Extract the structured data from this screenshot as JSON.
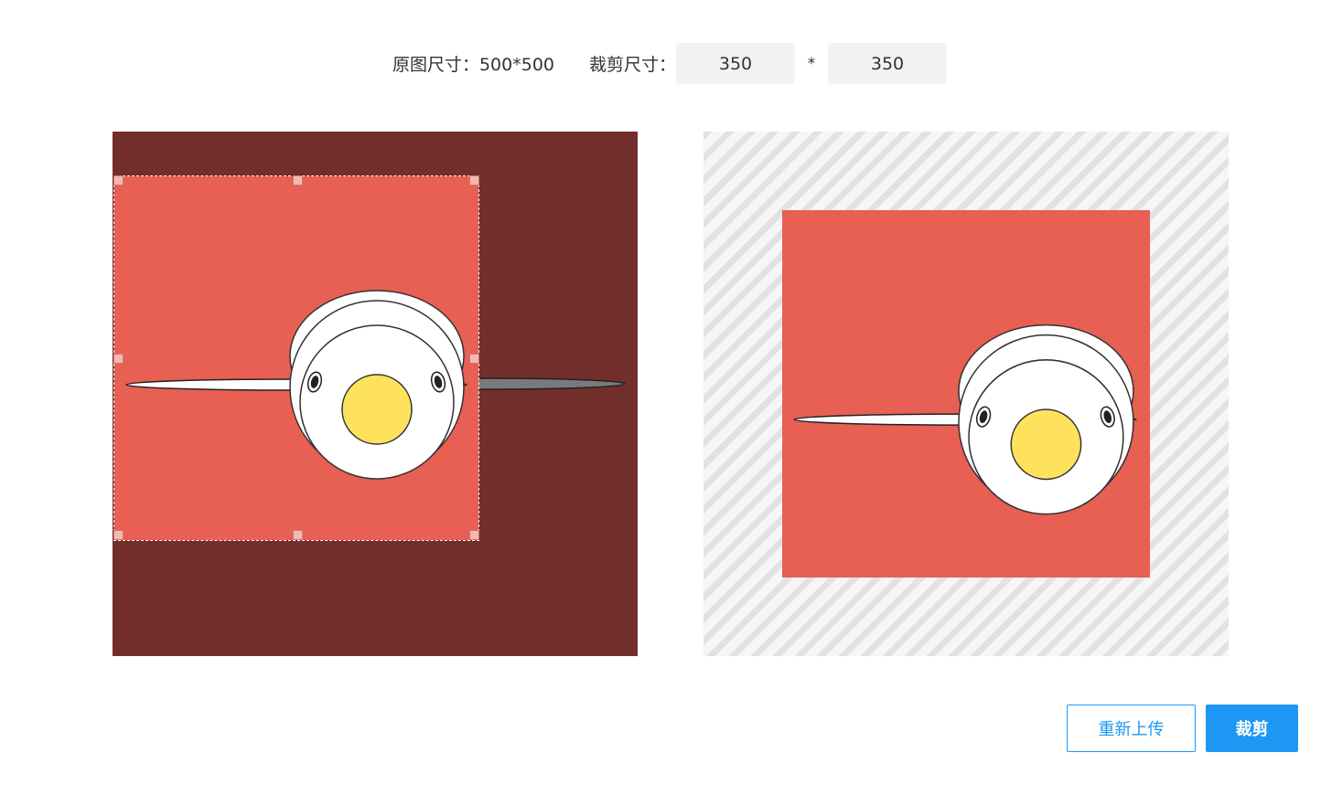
{
  "toolbar": {
    "original_size_label": "原图尺寸：500*500",
    "crop_size_label": "裁剪尺寸：",
    "crop_width": "350",
    "times_symbol": "*",
    "crop_height": "350"
  },
  "colors": {
    "editor_background": "#722e2b",
    "image_background": "#e85f53",
    "egg_yolk": "#ffe25c",
    "accent": "#1c97f3"
  },
  "icons": {
    "crop_handle": "square-handle-icon"
  },
  "actions": {
    "reupload_label": "重新上传",
    "crop_label": "裁剪"
  }
}
